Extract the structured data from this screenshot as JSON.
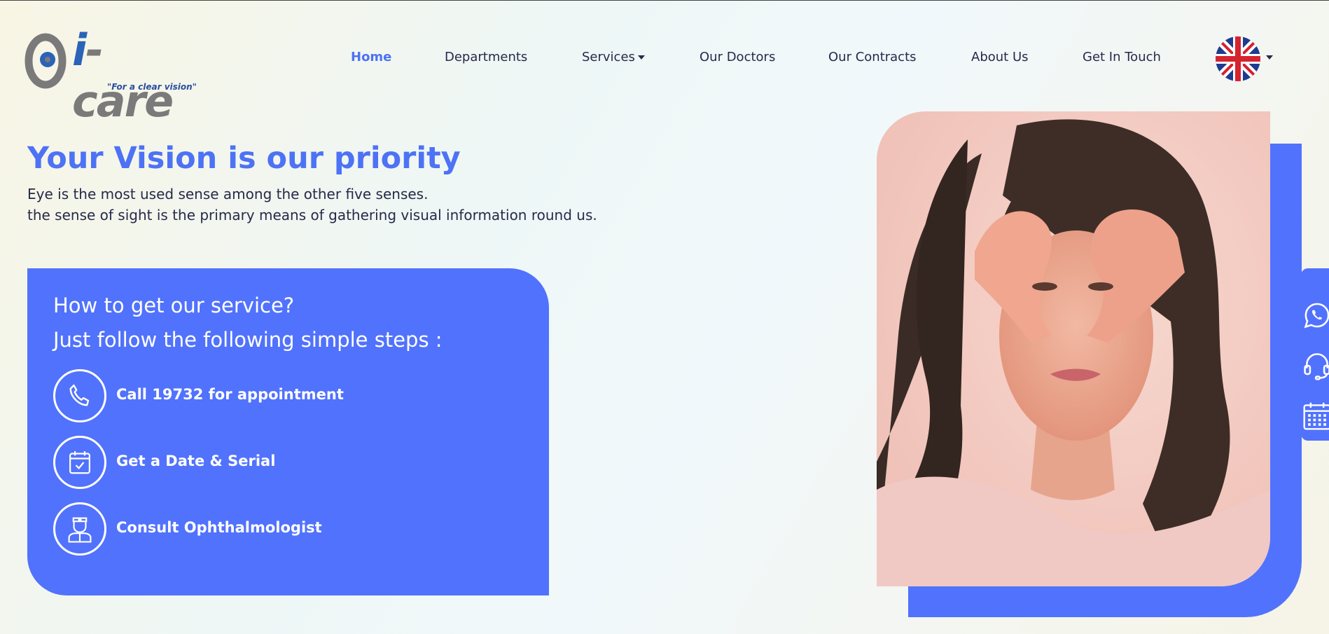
{
  "logo": {
    "brand_i": "i",
    "brand_rest": "-care",
    "tagline": "\"For a clear vision\""
  },
  "nav": {
    "items": [
      {
        "label": "Home",
        "active": true
      },
      {
        "label": "Departments"
      },
      {
        "label": "Services",
        "dropdown": true
      },
      {
        "label": "Our Doctors"
      },
      {
        "label": "Our Contracts"
      },
      {
        "label": "About Us"
      },
      {
        "label": "Get In Touch"
      }
    ],
    "language_flag": "uk-flag-icon"
  },
  "hero": {
    "title": "Your Vision is our priority",
    "line1": "Eye is the most used sense among the other five senses.",
    "line2": "the sense of sight is the primary means of gathering visual information round us."
  },
  "steps_card": {
    "heading1": "How to get our service?",
    "heading2": "Just follow the following simple steps :",
    "steps": [
      {
        "icon": "phone-icon",
        "label": "Call 19732 for appointment"
      },
      {
        "icon": "calendar-check-icon",
        "label": "Get a Date & Serial"
      },
      {
        "icon": "doctor-icon",
        "label": "Consult Ophthalmologist"
      }
    ]
  },
  "side_panel": {
    "icons": [
      "whatsapp-icon",
      "headset-icon",
      "calendar-icon"
    ]
  },
  "colors": {
    "accent": "#5172fc",
    "link_active": "#4d72f5",
    "text": "#262a4a"
  }
}
